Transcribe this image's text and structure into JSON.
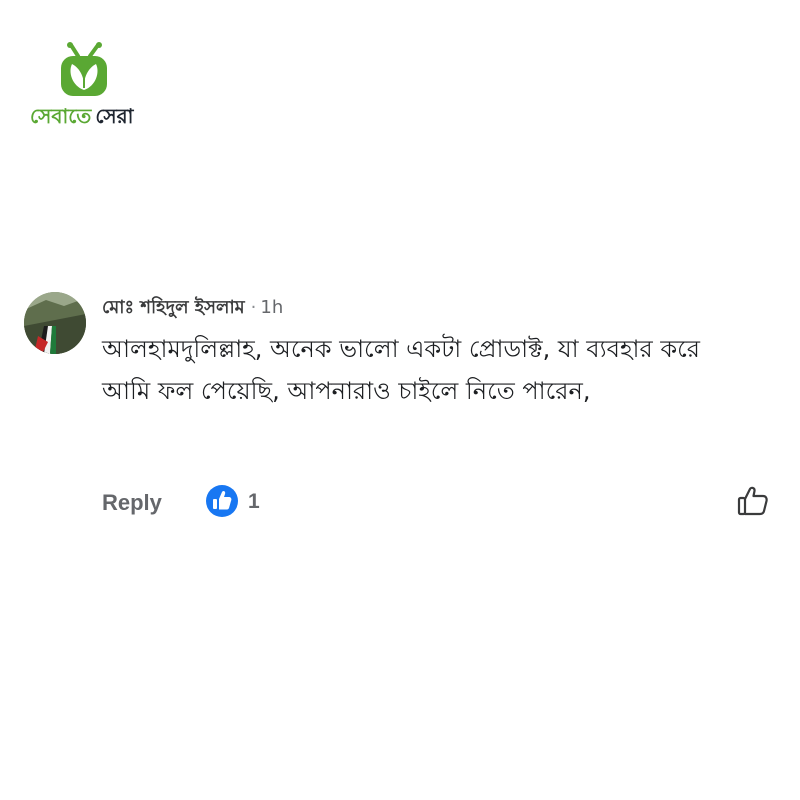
{
  "brand": {
    "logo_word1": "সেবাতে",
    "logo_word2": "সেরা",
    "colors": {
      "green": "#5aa833",
      "dark": "#1f2630"
    }
  },
  "comment": {
    "author": "মোঃ শহিদুল ইসলাম",
    "separator": "·",
    "timestamp": "1h",
    "text": "আলহামদুলিল্লাহ, অনেক ভালো একটা প্রোডাক্ট, যা ব্যবহার করে আমি ফল পেয়েছি, আপনারাও চাইলে নিতে পারেন,",
    "actions": {
      "reply_label": "Reply",
      "like_count": "1",
      "like_badge_icon": "thumbs-up-icon",
      "like_button_icon": "thumbs-up-outline-icon"
    },
    "colors": {
      "like_blue": "#1877f2",
      "meta_gray": "#65676b",
      "text": "#1c1e21"
    }
  }
}
